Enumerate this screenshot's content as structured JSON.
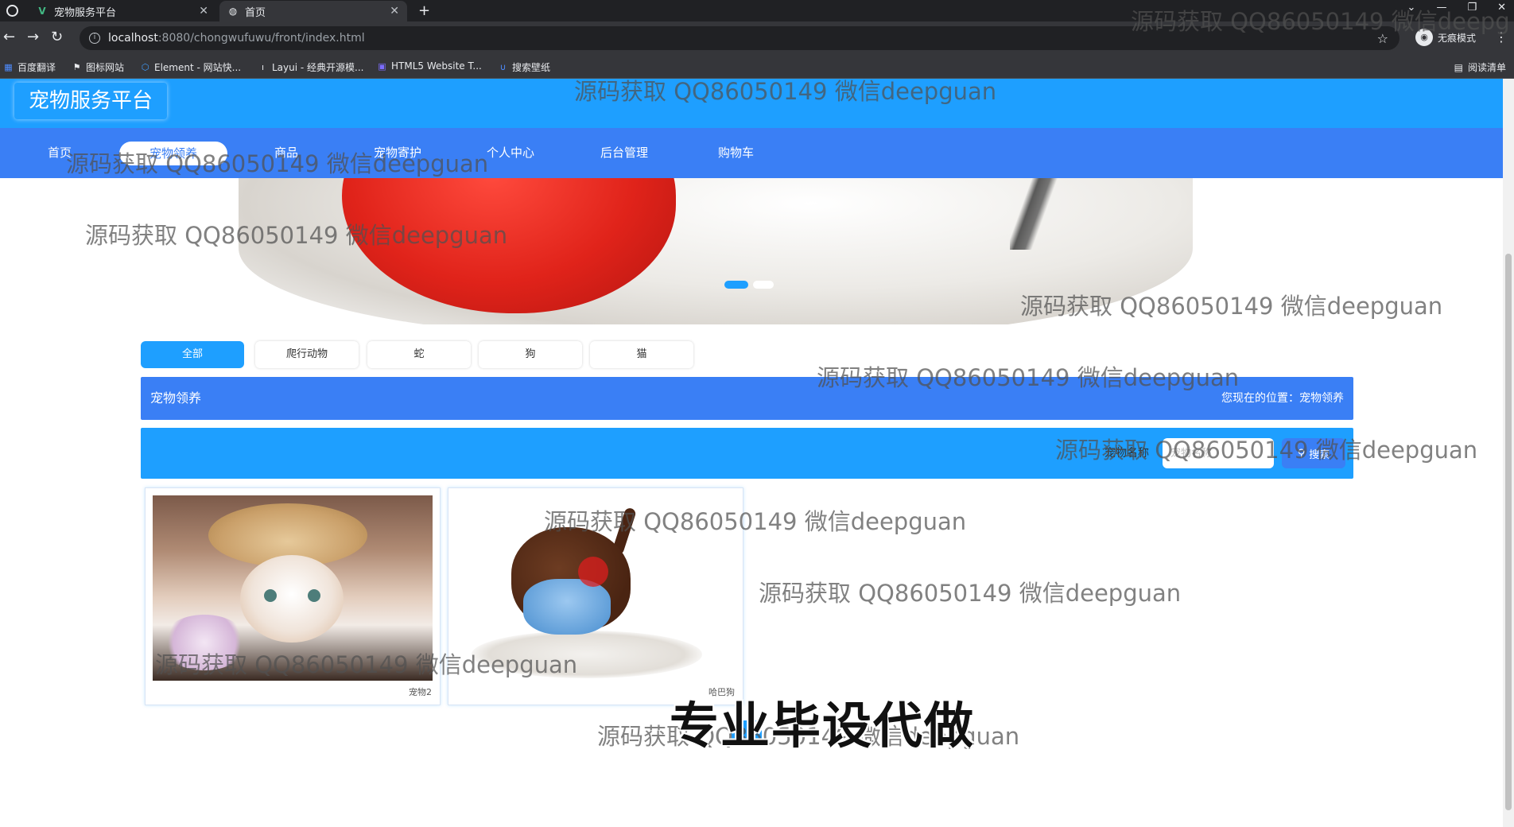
{
  "browser": {
    "tabs": [
      {
        "title": "宠物服务平台",
        "icon": "vue-logo-icon"
      },
      {
        "title": "首页",
        "icon": "globe-icon"
      }
    ],
    "new_tab": "+",
    "url_host": "localhost",
    "url_path": ":8080/chongwufuwu/front/index.html",
    "profile_label": "无痕模式",
    "bookmarks": [
      {
        "label": "百度翻译",
        "icon": "translate-icon"
      },
      {
        "label": "图标网站",
        "icon": "flag-icon"
      },
      {
        "label": "Element - 网站快...",
        "icon": "element-icon"
      },
      {
        "label": "Layui - 经典开源模...",
        "icon": "layui-icon"
      },
      {
        "label": "HTML5 Website T...",
        "icon": "html5-icon"
      },
      {
        "label": "搜索壁纸",
        "icon": "wallpaper-icon"
      }
    ],
    "reading_list": "阅读清单"
  },
  "site": {
    "title": "宠物服务平台",
    "nav": [
      "首页",
      "宠物领养",
      "商品",
      "宠物寄护",
      "个人中心",
      "后台管理",
      "购物车"
    ],
    "active_nav": "宠物领养"
  },
  "categories": [
    "全部",
    "爬行动物",
    "蛇",
    "狗",
    "猫"
  ],
  "breadcrumb": {
    "title": "宠物领养",
    "location": "您现在的位置：宠物领养"
  },
  "search": {
    "label": "宠物名称",
    "placeholder": "宠物名称",
    "button": "搜索"
  },
  "pets": [
    {
      "name": "宠物2"
    },
    {
      "name": "哈巴狗"
    }
  ],
  "pagination": {
    "current": "1"
  },
  "watermark_text": "源码获取 QQ86050149 微信deepguan",
  "watermark_partial": "源码获取 QQ86050149 微信deepg",
  "promo_text": "专业毕设代做",
  "colors": {
    "header": "#1e9fff",
    "nav": "#3a7ff5",
    "accent": "#1e9fff"
  }
}
